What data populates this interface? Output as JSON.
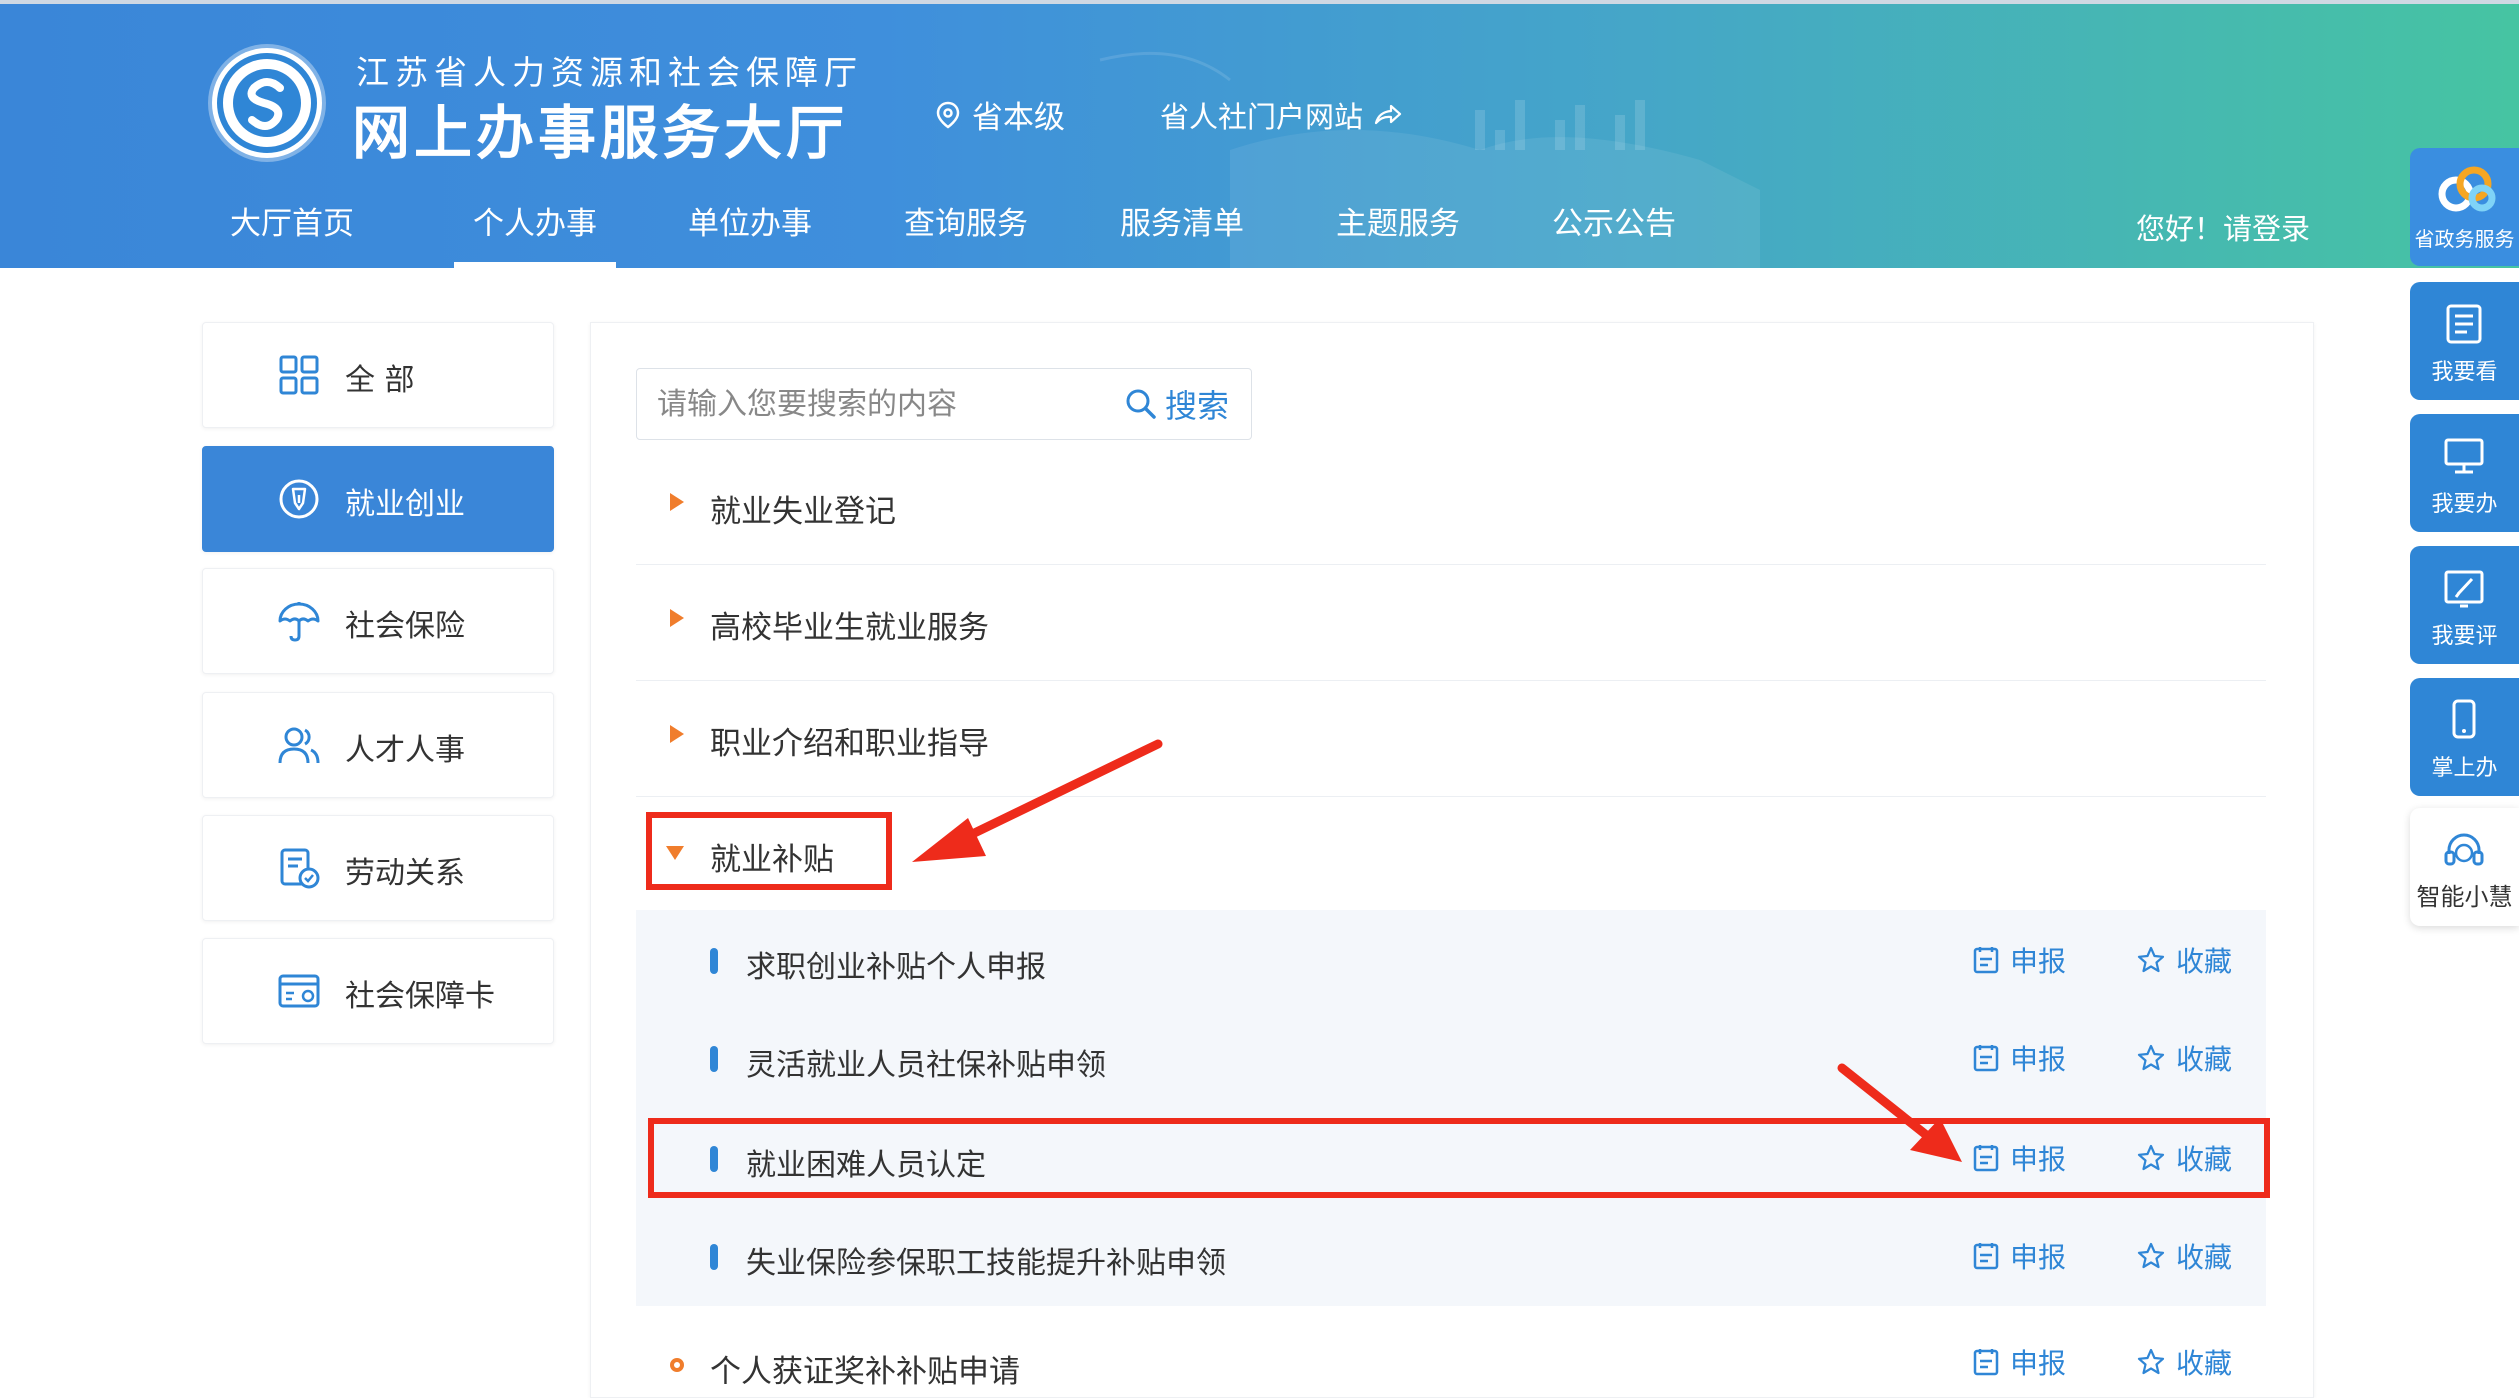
{
  "header": {
    "org_name": "江苏省人力资源和社会保障厅",
    "hall_name": "网上办事服务大厅",
    "location": "省本级",
    "portal_link": "省人社门户网站",
    "login_text": "您好！请登录"
  },
  "nav": {
    "items": [
      "大厅首页",
      "个人办事",
      "单位办事",
      "查询服务",
      "服务清单",
      "主题服务",
      "公示公告"
    ],
    "active": "个人办事"
  },
  "float_bar": {
    "items": [
      "省政务服务",
      "我要看",
      "我要办",
      "我要评",
      "掌上办",
      "智能小慧"
    ]
  },
  "sidebar": {
    "items": [
      {
        "label": "全 部",
        "icon": "grid-icon"
      },
      {
        "label": "就业创业",
        "icon": "employment-icon"
      },
      {
        "label": "社会保险",
        "icon": "umbrella-icon"
      },
      {
        "label": "人才人事",
        "icon": "people-icon"
      },
      {
        "label": "劳动关系",
        "icon": "contract-icon"
      },
      {
        "label": "社会保障卡",
        "icon": "card-icon"
      }
    ],
    "active": "就业创业"
  },
  "search": {
    "placeholder": "请输入您要搜索的内容",
    "button_label": "搜索"
  },
  "categories": [
    {
      "label": "就业失业登记",
      "expanded": false
    },
    {
      "label": "高校毕业生就业服务",
      "expanded": false
    },
    {
      "label": "职业介绍和职业指导",
      "expanded": false
    },
    {
      "label": "就业补贴",
      "expanded": true
    }
  ],
  "subitems": [
    {
      "label": "求职创业补贴个人申报"
    },
    {
      "label": "灵活就业人员社保补贴申领"
    },
    {
      "label": "就业困难人员认定"
    },
    {
      "label": "失业保险参保职工技能提升补贴申领"
    }
  ],
  "bottom_item": {
    "label": "个人获证奖补补贴申请"
  },
  "actions": {
    "apply_label": "申报",
    "favorite_label": "收藏"
  },
  "colors": {
    "primary": "#2f86d6",
    "accent_orange": "#f07d2c",
    "annotation_red": "#ee2b1b"
  }
}
